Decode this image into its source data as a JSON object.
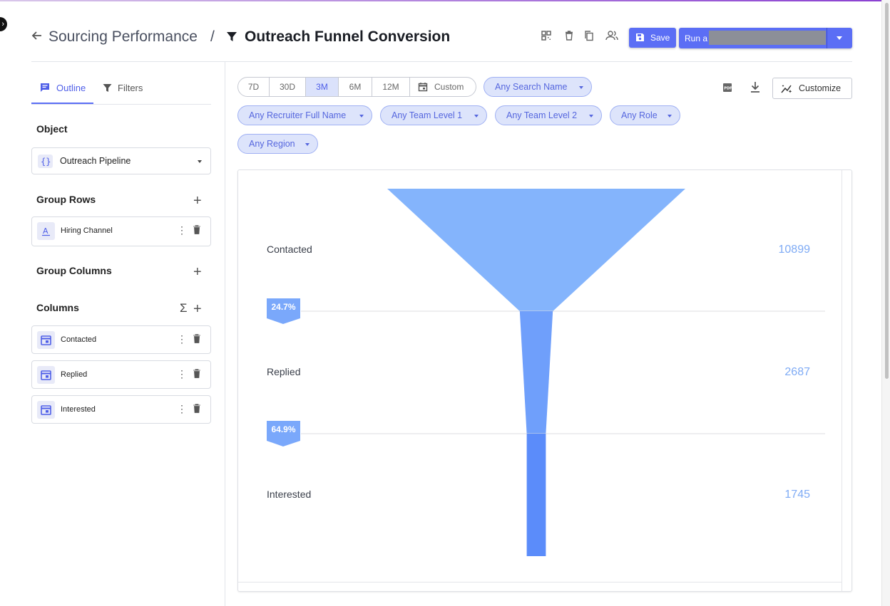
{
  "header": {
    "breadcrumb": "Sourcing Performance",
    "separator": "/",
    "title": "Outreach Funnel Conversion",
    "save_label": "Save",
    "run_label": "Run a",
    "icons": [
      "qr-code-icon",
      "trash-icon",
      "copy-icon",
      "people-icon"
    ]
  },
  "left_panel": {
    "tabs": [
      {
        "label": "Outline",
        "icon": "outline-icon",
        "active": true
      },
      {
        "label": "Filters",
        "icon": "filter-icon",
        "active": false
      }
    ],
    "object": {
      "title": "Object",
      "value": "Outreach Pipeline"
    },
    "group_rows": {
      "title": "Group Rows",
      "items": [
        "Hiring Channel"
      ]
    },
    "group_columns": {
      "title": "Group Columns",
      "items": []
    },
    "columns": {
      "title": "Columns",
      "items": [
        "Contacted",
        "Replied",
        "Interested"
      ]
    }
  },
  "filters": {
    "ranges": [
      "7D",
      "30D",
      "3M",
      "6M",
      "12M",
      "Custom"
    ],
    "selected_range": "3M",
    "chips": [
      "Any Search Name",
      "Any Recruiter Full Name",
      "Any Team Level 1",
      "Any Team Level 2",
      "Any Role",
      "Any Region"
    ],
    "customize_label": "Customize"
  },
  "colors": {
    "accent": "#5b6ef5",
    "chip_bg": "#dde4fb",
    "funnel_stages": [
      "#84b4fc",
      "#6f9ffb",
      "#5b8cfa"
    ],
    "value_text": "#7fabf5",
    "badge": "#7aa8fb"
  },
  "chart_data": {
    "type": "funnel",
    "stages": [
      {
        "label": "Contacted",
        "value": 10899
      },
      {
        "label": "Replied",
        "value": 2687
      },
      {
        "label": "Interested",
        "value": 1745
      }
    ],
    "conversion_labels": [
      "24.7%",
      "64.9%"
    ]
  }
}
